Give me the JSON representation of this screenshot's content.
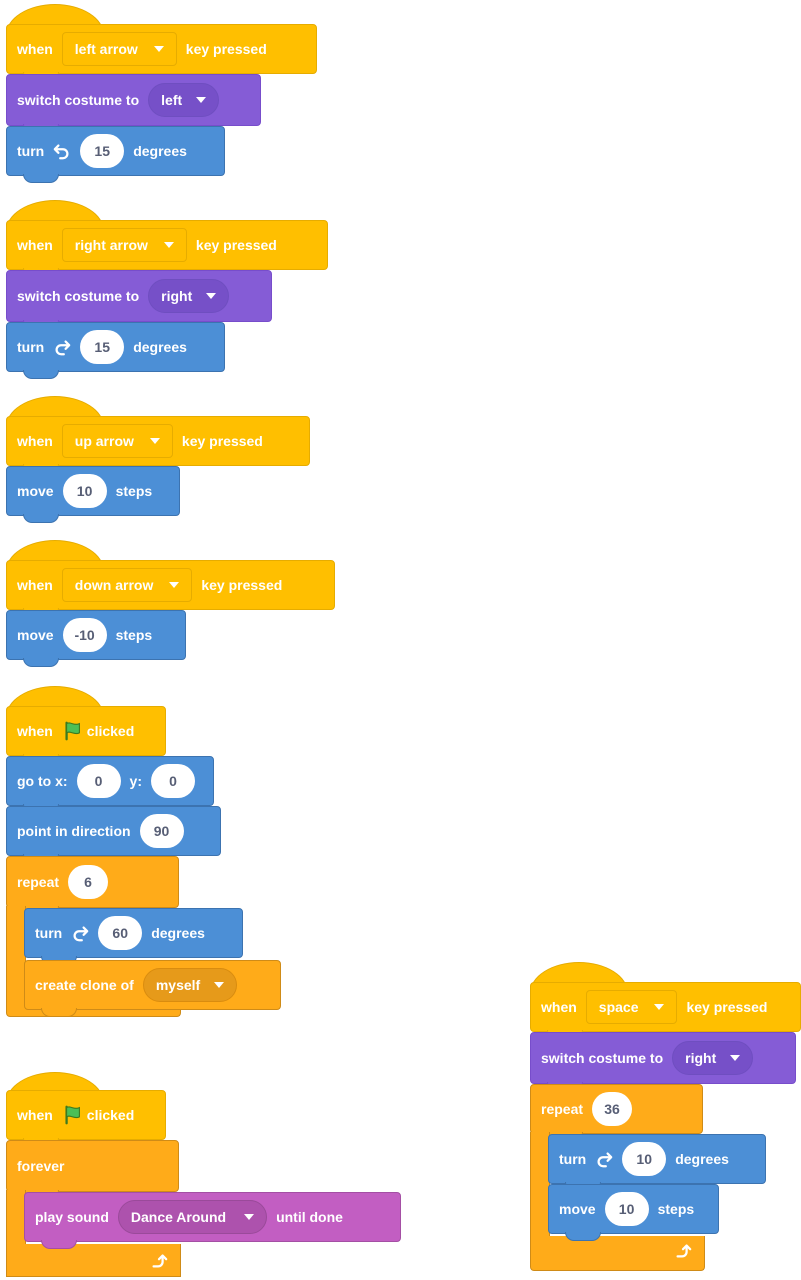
{
  "s1": {
    "when": "when",
    "key": "left arrow",
    "pressed": "key pressed",
    "switch": "switch costume to",
    "costume": "left",
    "turn": "turn",
    "deg": "15",
    "degrees": "degrees"
  },
  "s2": {
    "when": "when",
    "key": "right arrow",
    "pressed": "key pressed",
    "switch": "switch costume to",
    "costume": "right",
    "turn": "turn",
    "deg": "15",
    "degrees": "degrees"
  },
  "s3": {
    "when": "when",
    "key": "up arrow",
    "pressed": "key pressed",
    "move": "move",
    "steps_val": "10",
    "steps": "steps"
  },
  "s4": {
    "when": "when",
    "key": "down arrow",
    "pressed": "key pressed",
    "move": "move",
    "steps_val": "-10",
    "steps": "steps"
  },
  "s5": {
    "when": "when",
    "clicked": "clicked",
    "goto": "go to x:",
    "x": "0",
    "ylbl": "y:",
    "y": "0",
    "point": "point in direction",
    "dir": "90",
    "repeat": "repeat",
    "count": "6",
    "turn": "turn",
    "deg": "60",
    "degrees": "degrees",
    "create": "create clone of",
    "clone": "myself"
  },
  "s6": {
    "when": "when",
    "clicked": "clicked",
    "forever": "forever",
    "play": "play sound",
    "sound": "Dance Around",
    "until": "until done"
  },
  "s7": {
    "when": "when",
    "key": "space",
    "pressed": "key pressed",
    "switch": "switch costume to",
    "costume": "right",
    "repeat": "repeat",
    "count": "36",
    "turn": "turn",
    "deg": "10",
    "degrees": "degrees",
    "move": "move",
    "steps_val": "10",
    "steps": "steps"
  },
  "icons": {
    "flag": "green-flag-icon",
    "rotate_left": "rotate-left-icon",
    "rotate_right": "rotate-right-icon",
    "loop": "loop-arrow-icon",
    "caret": "dropdown-caret-icon"
  },
  "colors": {
    "events": "#ffbf00",
    "looks": "#855cd6",
    "motion": "#4c8fd6",
    "control": "#ffab19",
    "sound": "#c25ec2"
  }
}
